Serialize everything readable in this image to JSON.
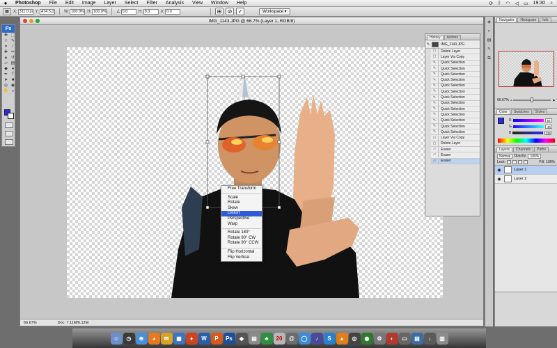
{
  "menubar": {
    "apple": "",
    "app_name": "Photoshop",
    "items": [
      "File",
      "Edit",
      "Image",
      "Layer",
      "Select",
      "Filter",
      "Analysis",
      "View",
      "Window",
      "Help"
    ],
    "clock": "19:30"
  },
  "options": {
    "x_value": "311.0 px",
    "y_value": "474.5 px",
    "w_value": "100.0%",
    "h_value": "100.0%",
    "angle_value": "0.0",
    "h_skew": "0.0",
    "v_skew": "0.0",
    "workspace": "Workspace"
  },
  "toolbox": {
    "badge": "Ps"
  },
  "document": {
    "title": "IMG_1143.JPG @ 66.7% (Layer 1, RGB/8)",
    "zoom": "66.67%",
    "doc_info": "Doc: 7.11M/6.12M"
  },
  "context_menu": {
    "items_group1": [
      "Free Transform"
    ],
    "items_group2": [
      "Scale",
      "Rotate",
      "Skew",
      "Distort",
      "Perspective",
      "Warp"
    ],
    "items_group3": [
      "Rotate 180°",
      "Rotate 90° CW",
      "Rotate 90° CCW"
    ],
    "items_group4": [
      "Flip Horizontal",
      "Flip Vertical"
    ],
    "active": "Distort"
  },
  "history": {
    "tabs": [
      "History",
      "Actions"
    ],
    "snapshot": "IMG_1143.JPG",
    "items": [
      "Delete Layer",
      "Layer Via Copy",
      "Quick Selection",
      "Quick Selection",
      "Quick Selection",
      "Quick Selection",
      "Quick Selection",
      "Quick Selection",
      "Quick Selection",
      "Quick Selection",
      "Quick Selection",
      "Quick Selection",
      "Quick Selection",
      "Quick Selection",
      "Quick Selection",
      "Layer Via Copy",
      "Delete Layer",
      "Eraser",
      "Eraser",
      "Eraser"
    ],
    "selected_index": 19
  },
  "navigator": {
    "tabs": [
      "Navigator",
      "Histogram",
      "Info"
    ],
    "zoom": "66.67%"
  },
  "color_panel": {
    "tabs": [
      "Color",
      "Swatches",
      "Styles"
    ],
    "r": "54",
    "g": "45",
    "b": "235"
  },
  "layers_panel": {
    "tabs": [
      "Layers",
      "Channels",
      "Paths"
    ],
    "blend_mode": "Normal",
    "opacity_label": "Opacity:",
    "opacity": "100%",
    "lock_label": "Lock:",
    "fill_label": "Fill:",
    "fill": "100%",
    "layers": [
      {
        "name": "Layer 1",
        "selected": true
      },
      {
        "name": "Layer 2",
        "selected": false
      }
    ]
  },
  "colors": {
    "foreground": "#2a2ae6",
    "accent": "#2f5bd6"
  }
}
